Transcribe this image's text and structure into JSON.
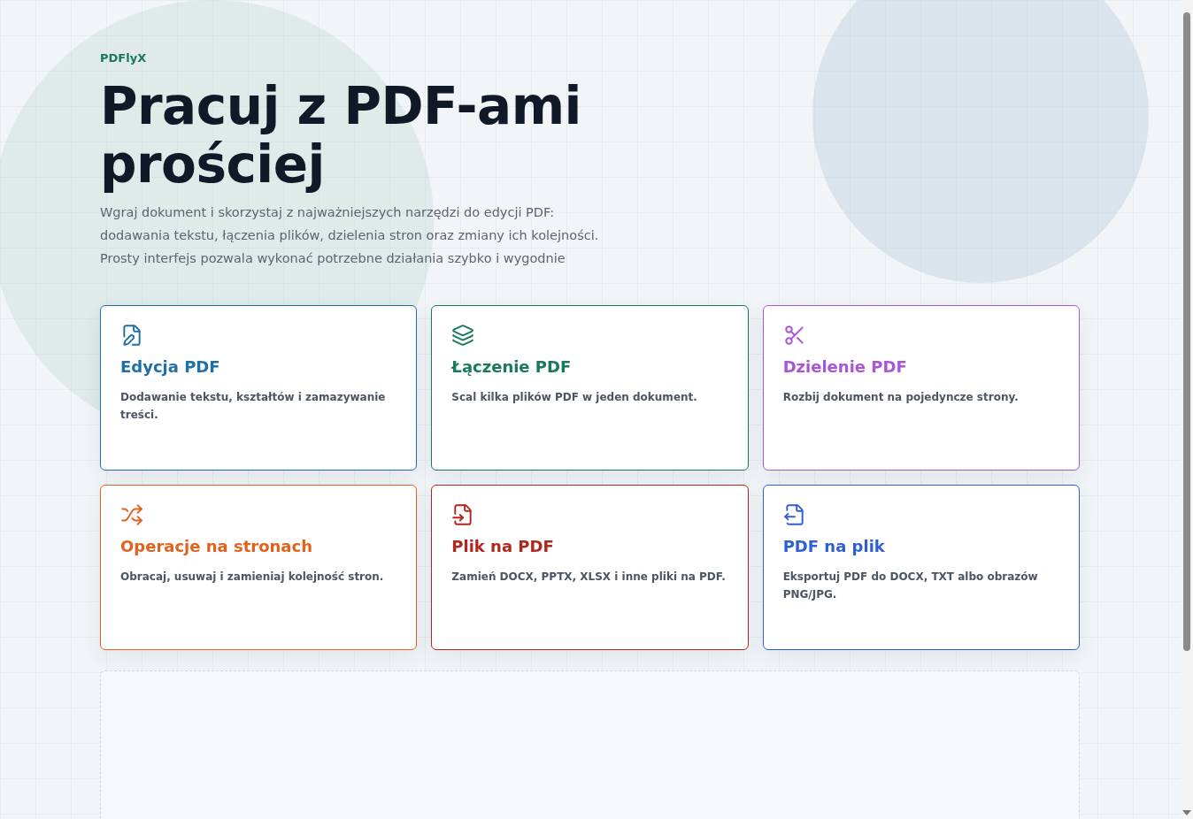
{
  "brand": "PDFlyX",
  "title_lines": [
    "Pracuj z PDF-ami",
    "prościej"
  ],
  "intro_lines": [
    "Wgraj dokument i skorzystaj z najważniejszych narzędzi do edycji PDF:",
    "dodawania tekstu, łączenia plików, dzielenia stron oraz zmiany ich kolejności.",
    "Prosty interfejs pozwala wykonać potrzebne działania szybko i wygodnie"
  ],
  "tools": [
    {
      "kind": "edit",
      "title": "Edycja PDF",
      "description": "Dodawanie tekstu, kształtów i zamazywanie treści.",
      "color": "#1f6fa8"
    },
    {
      "kind": "merge",
      "title": "Łączenie PDF",
      "description": "Scal kilka plików PDF w jeden dokument.",
      "color": "#17795e"
    },
    {
      "kind": "split",
      "title": "Dzielenie PDF",
      "description": "Rozbij dokument na pojedyncze strony.",
      "color": "#a855d8"
    },
    {
      "kind": "pages",
      "title": "Operacje na stronach",
      "description": "Obracaj, usuwaj i zamieniaj kolejność stron.",
      "color": "#e0621c"
    },
    {
      "kind": "import",
      "title": "Plik na PDF",
      "description": "Zamień DOCX, PPTX, XLSX i inne pliki na PDF.",
      "color": "#b3261e"
    },
    {
      "kind": "export",
      "title": "PDF na plik",
      "description": "Eksportuj PDF do DOCX, TXT albo obrazów PNG/JPG.",
      "color": "#2f5fd6"
    }
  ]
}
